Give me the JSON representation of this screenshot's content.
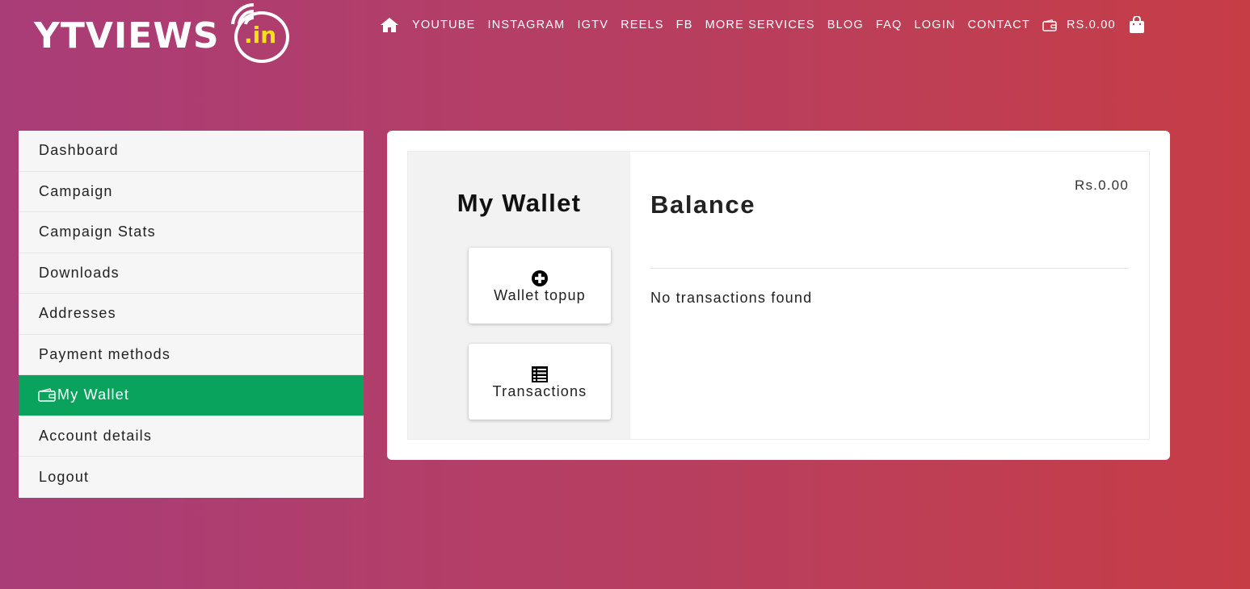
{
  "brand": {
    "name": "YTVIEWS",
    "tld": ".in",
    "tld_color": "#f5e11a"
  },
  "nav": {
    "items": [
      "YOUTUBE",
      "INSTAGRAM",
      "IGTV",
      "REELS",
      "FB",
      "MORE SERVICES",
      "BLOG",
      "FAQ",
      "LOGIN",
      "CONTACT"
    ],
    "cart_amount": "RS.0.00",
    "icons": [
      "home-icon",
      "wallet-icon",
      "shopping-bag-icon"
    ]
  },
  "sidebar": {
    "items": [
      {
        "label": "Dashboard"
      },
      {
        "label": "Campaign"
      },
      {
        "label": "Campaign Stats"
      },
      {
        "label": "Downloads"
      },
      {
        "label": "Addresses"
      },
      {
        "label": "Payment methods"
      },
      {
        "label": "My Wallet",
        "active": true
      },
      {
        "label": "Account details"
      },
      {
        "label": "Logout"
      }
    ],
    "active_color": "#0aa35e"
  },
  "wallet": {
    "title": "My Wallet",
    "topup_label": "Wallet topup",
    "transactions_label": "Transactions",
    "balance_title": "Balance",
    "balance_amount": "Rs.0.00",
    "empty_message": "No transactions found"
  },
  "colors": {
    "gradient_start": "#a93d78",
    "gradient_end": "#c63d46"
  }
}
